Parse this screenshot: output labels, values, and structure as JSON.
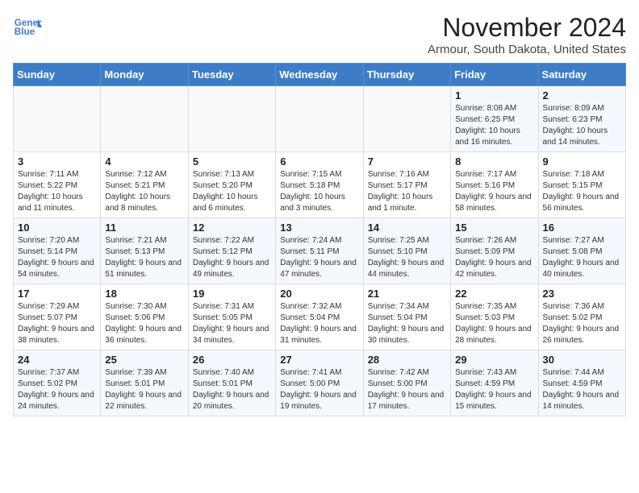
{
  "logo": {
    "line1": "General",
    "line2": "Blue"
  },
  "title": "November 2024",
  "location": "Armour, South Dakota, United States",
  "weekdays": [
    "Sunday",
    "Monday",
    "Tuesday",
    "Wednesday",
    "Thursday",
    "Friday",
    "Saturday"
  ],
  "weeks": [
    [
      {
        "day": "",
        "info": ""
      },
      {
        "day": "",
        "info": ""
      },
      {
        "day": "",
        "info": ""
      },
      {
        "day": "",
        "info": ""
      },
      {
        "day": "",
        "info": ""
      },
      {
        "day": "1",
        "info": "Sunrise: 8:08 AM\nSunset: 6:25 PM\nDaylight: 10 hours and 16 minutes."
      },
      {
        "day": "2",
        "info": "Sunrise: 8:09 AM\nSunset: 6:23 PM\nDaylight: 10 hours and 14 minutes."
      }
    ],
    [
      {
        "day": "3",
        "info": "Sunrise: 7:11 AM\nSunset: 5:22 PM\nDaylight: 10 hours and 11 minutes."
      },
      {
        "day": "4",
        "info": "Sunrise: 7:12 AM\nSunset: 5:21 PM\nDaylight: 10 hours and 8 minutes."
      },
      {
        "day": "5",
        "info": "Sunrise: 7:13 AM\nSunset: 5:20 PM\nDaylight: 10 hours and 6 minutes."
      },
      {
        "day": "6",
        "info": "Sunrise: 7:15 AM\nSunset: 5:18 PM\nDaylight: 10 hours and 3 minutes."
      },
      {
        "day": "7",
        "info": "Sunrise: 7:16 AM\nSunset: 5:17 PM\nDaylight: 10 hours and 1 minute."
      },
      {
        "day": "8",
        "info": "Sunrise: 7:17 AM\nSunset: 5:16 PM\nDaylight: 9 hours and 58 minutes."
      },
      {
        "day": "9",
        "info": "Sunrise: 7:18 AM\nSunset: 5:15 PM\nDaylight: 9 hours and 56 minutes."
      }
    ],
    [
      {
        "day": "10",
        "info": "Sunrise: 7:20 AM\nSunset: 5:14 PM\nDaylight: 9 hours and 54 minutes."
      },
      {
        "day": "11",
        "info": "Sunrise: 7:21 AM\nSunset: 5:13 PM\nDaylight: 9 hours and 51 minutes."
      },
      {
        "day": "12",
        "info": "Sunrise: 7:22 AM\nSunset: 5:12 PM\nDaylight: 9 hours and 49 minutes."
      },
      {
        "day": "13",
        "info": "Sunrise: 7:24 AM\nSunset: 5:11 PM\nDaylight: 9 hours and 47 minutes."
      },
      {
        "day": "14",
        "info": "Sunrise: 7:25 AM\nSunset: 5:10 PM\nDaylight: 9 hours and 44 minutes."
      },
      {
        "day": "15",
        "info": "Sunrise: 7:26 AM\nSunset: 5:09 PM\nDaylight: 9 hours and 42 minutes."
      },
      {
        "day": "16",
        "info": "Sunrise: 7:27 AM\nSunset: 5:08 PM\nDaylight: 9 hours and 40 minutes."
      }
    ],
    [
      {
        "day": "17",
        "info": "Sunrise: 7:29 AM\nSunset: 5:07 PM\nDaylight: 9 hours and 38 minutes."
      },
      {
        "day": "18",
        "info": "Sunrise: 7:30 AM\nSunset: 5:06 PM\nDaylight: 9 hours and 36 minutes."
      },
      {
        "day": "19",
        "info": "Sunrise: 7:31 AM\nSunset: 5:05 PM\nDaylight: 9 hours and 34 minutes."
      },
      {
        "day": "20",
        "info": "Sunrise: 7:32 AM\nSunset: 5:04 PM\nDaylight: 9 hours and 31 minutes."
      },
      {
        "day": "21",
        "info": "Sunrise: 7:34 AM\nSunset: 5:04 PM\nDaylight: 9 hours and 30 minutes."
      },
      {
        "day": "22",
        "info": "Sunrise: 7:35 AM\nSunset: 5:03 PM\nDaylight: 9 hours and 28 minutes."
      },
      {
        "day": "23",
        "info": "Sunrise: 7:36 AM\nSunset: 5:02 PM\nDaylight: 9 hours and 26 minutes."
      }
    ],
    [
      {
        "day": "24",
        "info": "Sunrise: 7:37 AM\nSunset: 5:02 PM\nDaylight: 9 hours and 24 minutes."
      },
      {
        "day": "25",
        "info": "Sunrise: 7:39 AM\nSunset: 5:01 PM\nDaylight: 9 hours and 22 minutes."
      },
      {
        "day": "26",
        "info": "Sunrise: 7:40 AM\nSunset: 5:01 PM\nDaylight: 9 hours and 20 minutes."
      },
      {
        "day": "27",
        "info": "Sunrise: 7:41 AM\nSunset: 5:00 PM\nDaylight: 9 hours and 19 minutes."
      },
      {
        "day": "28",
        "info": "Sunrise: 7:42 AM\nSunset: 5:00 PM\nDaylight: 9 hours and 17 minutes."
      },
      {
        "day": "29",
        "info": "Sunrise: 7:43 AM\nSunset: 4:59 PM\nDaylight: 9 hours and 15 minutes."
      },
      {
        "day": "30",
        "info": "Sunrise: 7:44 AM\nSunset: 4:59 PM\nDaylight: 9 hours and 14 minutes."
      }
    ]
  ]
}
